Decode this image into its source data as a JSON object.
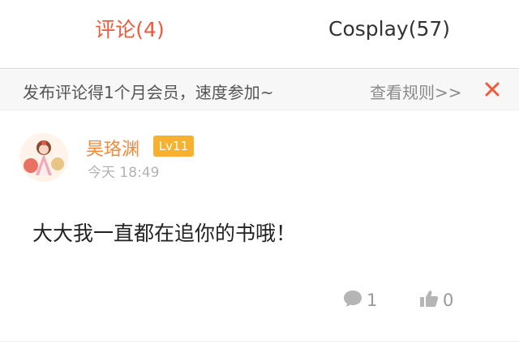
{
  "tabs": [
    {
      "label": "评论(4)",
      "active": true
    },
    {
      "label": "Cosplay(57)",
      "active": false
    }
  ],
  "notice": {
    "text": "发布评论得1个月会员，速度参加~",
    "rules_link": "查看规则>>",
    "close_icon": "close-icon"
  },
  "comment": {
    "username": "昊珞渊",
    "level": "Lv11",
    "time": "今天 18:49",
    "text": "大大我一直都在追你的书哦！",
    "reply_count": "1",
    "like_count": "0"
  },
  "colors": {
    "accent": "#f05a3a",
    "username": "#f28a3a",
    "badge": "#f7b12f",
    "muted": "#999999"
  }
}
